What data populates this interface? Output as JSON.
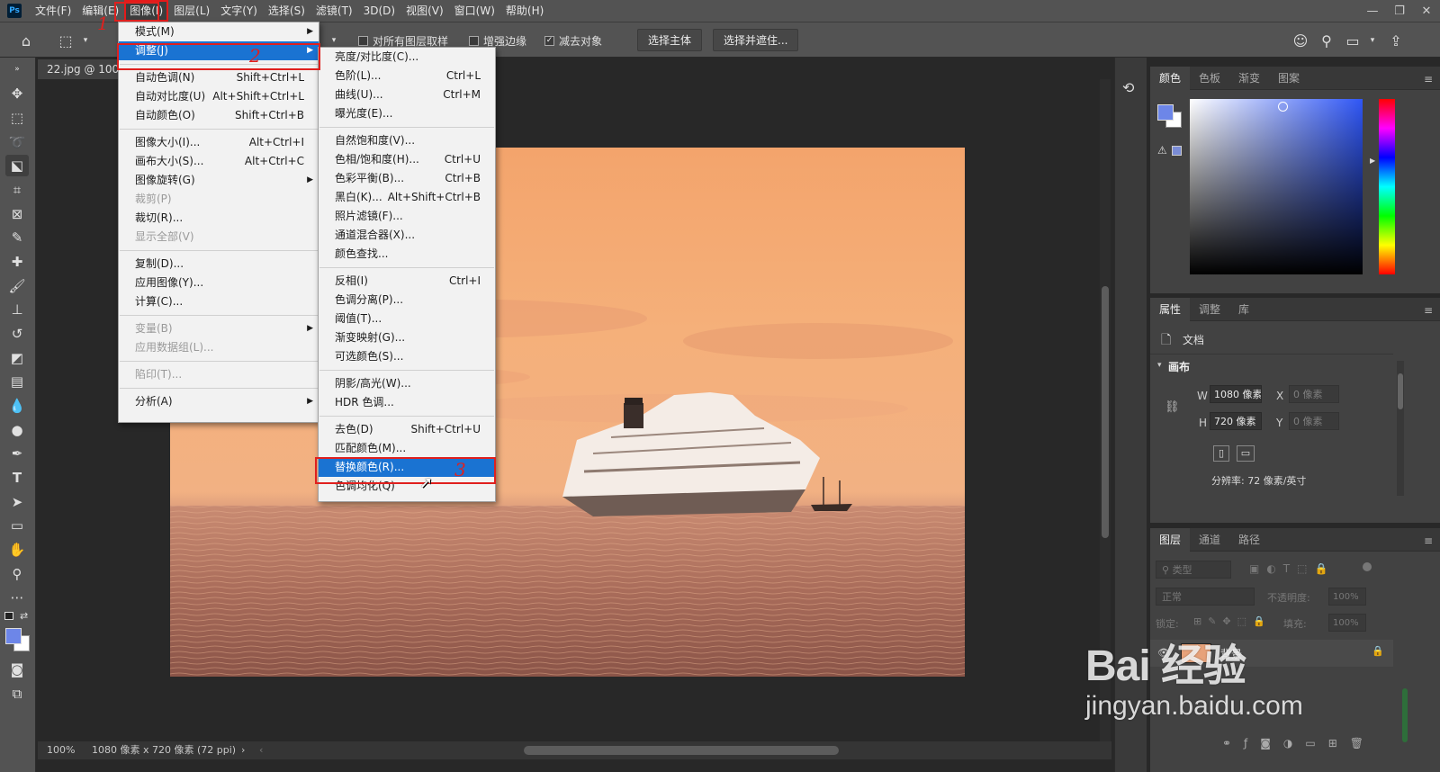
{
  "app": {
    "logo_text": "Ps"
  },
  "menubar": {
    "items": [
      "文件(F)",
      "编辑(E)",
      "图像(I)",
      "图层(L)",
      "文字(Y)",
      "选择(S)",
      "滤镜(T)",
      "3D(D)",
      "视图(V)",
      "窗口(W)",
      "帮助(H)"
    ],
    "active_index": 2
  },
  "window_controls": {
    "minimize": "—",
    "restore": "❐",
    "close": "✕"
  },
  "options": {
    "sample_all_layers": {
      "label": "对所有图层取样",
      "checked": false
    },
    "enhance_edge": {
      "label": "增强边缘",
      "checked": false
    },
    "subtract_object": {
      "label": "减去对象",
      "checked": true
    },
    "select_subject": "选择主体",
    "select_and_mask": "选择并遮住..."
  },
  "document": {
    "tab_title": "22.jpg @ 100%",
    "status_zoom": "100%",
    "status_info": "1080 像素 x 720 像素 (72 ppi)"
  },
  "image_menu": {
    "items": [
      {
        "label": "模式(M)",
        "submenu": true
      },
      {
        "label": "调整(J)",
        "submenu": true,
        "highlighted": true
      },
      {
        "sep": true
      },
      {
        "label": "自动色调(N)",
        "shortcut": "Shift+Ctrl+L"
      },
      {
        "label": "自动对比度(U)",
        "shortcut": "Alt+Shift+Ctrl+L"
      },
      {
        "label": "自动颜色(O)",
        "shortcut": "Shift+Ctrl+B"
      },
      {
        "sep": true
      },
      {
        "label": "图像大小(I)...",
        "shortcut": "Alt+Ctrl+I"
      },
      {
        "label": "画布大小(S)...",
        "shortcut": "Alt+Ctrl+C"
      },
      {
        "label": "图像旋转(G)",
        "submenu": true
      },
      {
        "label": "裁剪(P)",
        "disabled": true
      },
      {
        "label": "裁切(R)..."
      },
      {
        "label": "显示全部(V)",
        "disabled": true
      },
      {
        "sep": true
      },
      {
        "label": "复制(D)..."
      },
      {
        "label": "应用图像(Y)..."
      },
      {
        "label": "计算(C)..."
      },
      {
        "sep": true
      },
      {
        "label": "变量(B)",
        "submenu": true,
        "disabled": true
      },
      {
        "label": "应用数据组(L)...",
        "disabled": true
      },
      {
        "sep": true
      },
      {
        "label": "陷印(T)...",
        "disabled": true
      },
      {
        "sep": true
      },
      {
        "label": "分析(A)",
        "submenu": true
      }
    ]
  },
  "adjust_menu": {
    "items": [
      {
        "label": "亮度/对比度(C)..."
      },
      {
        "label": "色阶(L)...",
        "shortcut": "Ctrl+L"
      },
      {
        "label": "曲线(U)...",
        "shortcut": "Ctrl+M"
      },
      {
        "label": "曝光度(E)..."
      },
      {
        "sep": true
      },
      {
        "label": "自然饱和度(V)..."
      },
      {
        "label": "色相/饱和度(H)...",
        "shortcut": "Ctrl+U"
      },
      {
        "label": "色彩平衡(B)...",
        "shortcut": "Ctrl+B"
      },
      {
        "label": "黑白(K)...",
        "shortcut": "Alt+Shift+Ctrl+B"
      },
      {
        "label": "照片滤镜(F)..."
      },
      {
        "label": "通道混合器(X)..."
      },
      {
        "label": "颜色查找..."
      },
      {
        "sep": true
      },
      {
        "label": "反相(I)",
        "shortcut": "Ctrl+I"
      },
      {
        "label": "色调分离(P)..."
      },
      {
        "label": "阈值(T)..."
      },
      {
        "label": "渐变映射(G)..."
      },
      {
        "label": "可选颜色(S)..."
      },
      {
        "sep": true
      },
      {
        "label": "阴影/高光(W)..."
      },
      {
        "label": "HDR 色调..."
      },
      {
        "sep": true
      },
      {
        "label": "去色(D)",
        "shortcut": "Shift+Ctrl+U"
      },
      {
        "label": "匹配颜色(M)..."
      },
      {
        "label": "替换颜色(R)...",
        "highlighted": true
      },
      {
        "label": "色调均化(Q)"
      }
    ]
  },
  "annotations": {
    "step1": "1",
    "step2": "2",
    "step3": "3"
  },
  "color_panel": {
    "tabs": [
      "颜色",
      "色板",
      "渐变",
      "图案"
    ],
    "active_tab": 0,
    "foreground": "#6d86e8",
    "background": "#ffffff",
    "warning_icon": "⚠"
  },
  "properties_panel": {
    "tabs": [
      "属性",
      "调整",
      "库"
    ],
    "active_tab": 0,
    "doc_label": "文档",
    "canvas_section": "画布",
    "w_label": "W",
    "w_value": "1080 像素",
    "h_label": "H",
    "h_value": "720 像素",
    "x_label": "X",
    "x_value": "0 像素",
    "y_label": "Y",
    "y_value": "0 像素",
    "resolution": "分辨率: 72 像素/英寸"
  },
  "layers_panel": {
    "tabs": [
      "图层",
      "通道",
      "路径"
    ],
    "active_tab": 0,
    "filter_kind": "类型",
    "blend_mode": "正常",
    "opacity_label": "不透明度:",
    "opacity_value": "100%",
    "lock_label": "锁定:",
    "fill_label": "填充:",
    "fill_value": "100%",
    "layer_name": "背景"
  },
  "watermark": {
    "main": "Bai 经验",
    "url": "jingyan.baidu.com"
  }
}
